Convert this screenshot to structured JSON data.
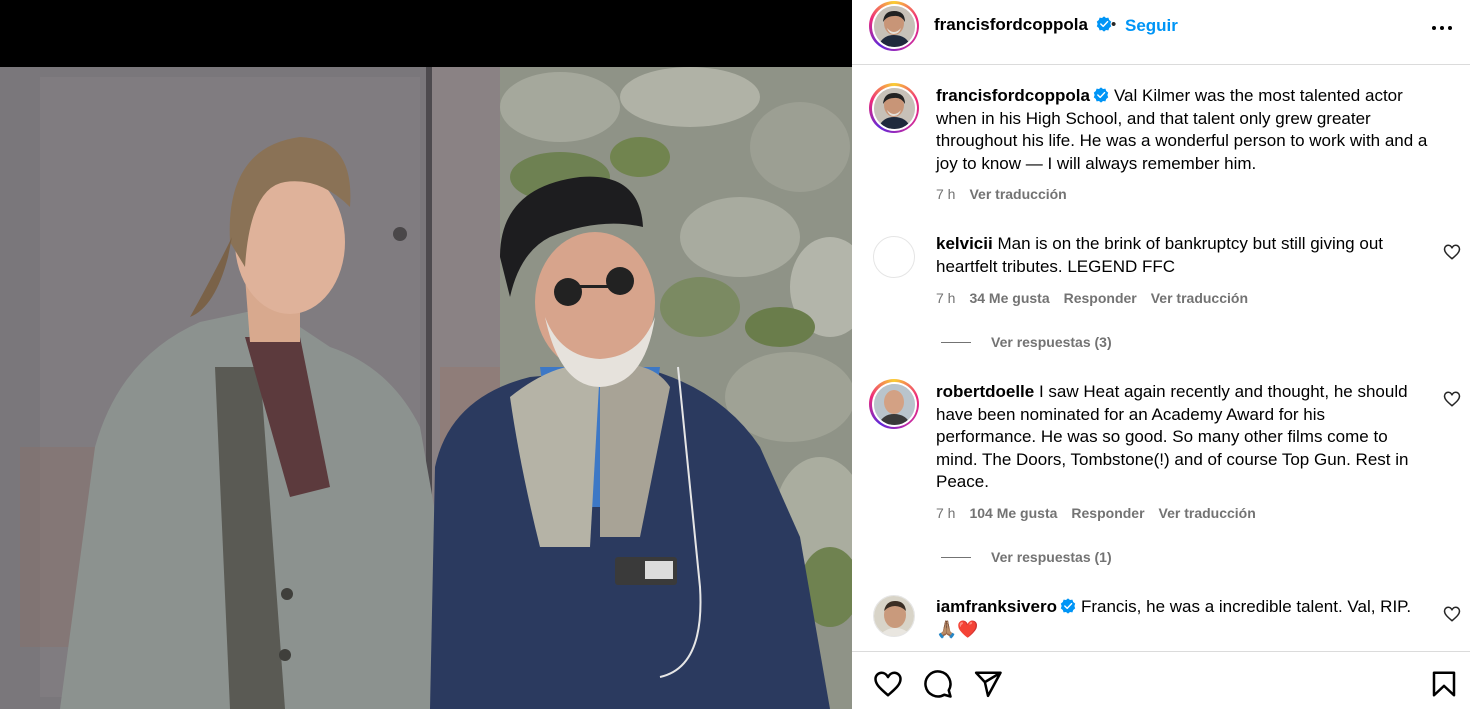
{
  "post": {
    "username": "francisfordcoppola",
    "separator": "•",
    "follow_label": "Seguir",
    "caption": "Val Kilmer was the most talented actor when in his High School, and that talent only grew greater throughout his life. He was a wonderful person to work with and a joy to know — I will always remember him.",
    "time": "7 h",
    "translate_label": "Ver traducción"
  },
  "comments": [
    {
      "username": "kelvicii",
      "text": "Man is on the brink of bankruptcy but still giving out heartfelt tributes. LEGEND FFC",
      "time": "7 h",
      "likes": "34 Me gusta",
      "reply_label": "Responder",
      "translate_label": "Ver traducción",
      "replies_label": "Ver respuestas (3)"
    },
    {
      "username": "robertdoelle",
      "text": "I saw Heat again recently and thought, he should have been nominated for an Academy Award for his performance. He was so good. So many other films come to mind. The Doors, Tombstone(!) and of course Top Gun. Rest in Peace.",
      "time": "7 h",
      "likes": "104 Me gusta",
      "reply_label": "Responder",
      "translate_label": "Ver traducción",
      "replies_label": "Ver respuestas (1)"
    },
    {
      "username": "iamfranksivero",
      "text": "Francis, he was a incredible talent. Val, RIP.",
      "emoji": "🙏🏽❤️"
    }
  ],
  "icons": {
    "like": "heart-icon",
    "comment": "comment-icon",
    "share": "share-icon",
    "save": "bookmark-icon",
    "more": "more-options-icon",
    "verified": "verified-badge-icon"
  },
  "colors": {
    "link": "#0095f6",
    "verified": "#0095f6",
    "secondary_text": "#737373",
    "divider": "#dbdbdb"
  }
}
